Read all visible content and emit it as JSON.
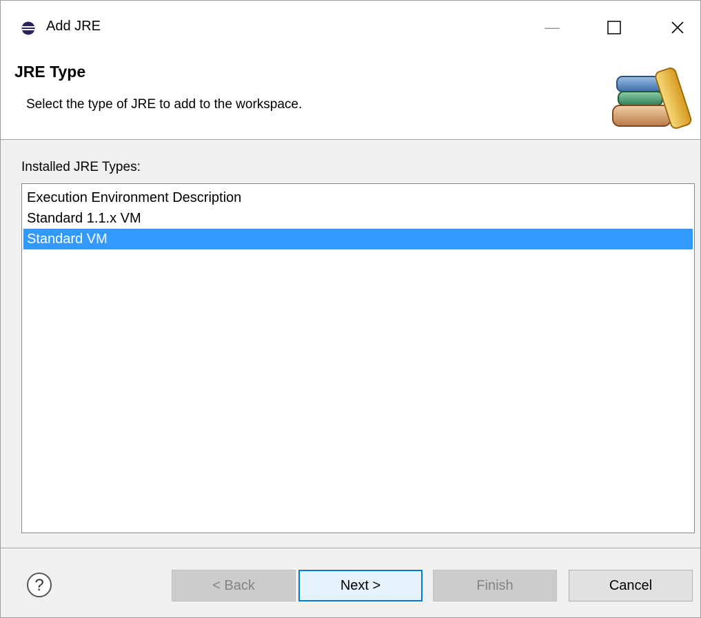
{
  "window": {
    "title": "Add JRE",
    "controls": {
      "minimize": "—",
      "maximize": "☐",
      "close": "✕"
    }
  },
  "banner": {
    "title": "JRE Type",
    "description": "Select the type of JRE to add to the workspace.",
    "icon": "books-icon"
  },
  "list": {
    "label": "Installed JRE Types:",
    "items": [
      {
        "label": "Execution Environment Description",
        "selected": false
      },
      {
        "label": "Standard 1.1.x VM",
        "selected": false
      },
      {
        "label": "Standard VM",
        "selected": true
      }
    ]
  },
  "buttons": {
    "help_icon": "help-icon",
    "back": "< Back",
    "next": "Next >",
    "finish": "Finish",
    "cancel": "Cancel"
  },
  "colors": {
    "selection": "#3399ff",
    "default_button_border": "#0078d7",
    "disabled_text": "#838383"
  }
}
